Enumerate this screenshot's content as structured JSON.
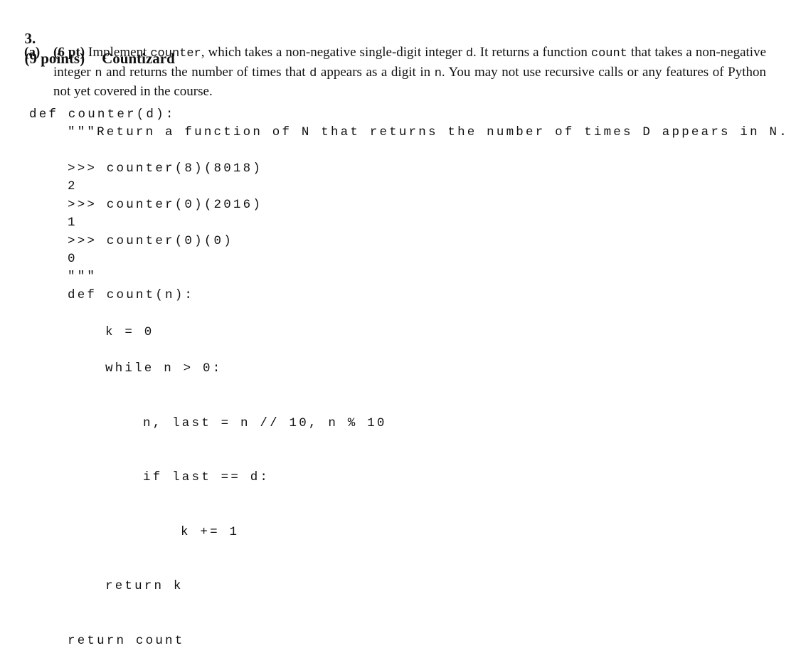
{
  "question": {
    "number": "3.",
    "points": "(9 points)",
    "title": "Countizard"
  },
  "part_a": {
    "label": "(a)",
    "points": "(6 pt)",
    "text_1": " Implement ",
    "code_1": "counter",
    "text_2": ", which takes a non-negative single-digit integer ",
    "code_2": "d",
    "text_3": ". It returns a function ",
    "code_3": "count",
    "text_4": " that takes a non-negative integer ",
    "code_4": "n",
    "text_5": " and returns the number of times that ",
    "code_5": "d",
    "text_6": " appears as a digit in ",
    "code_6": "n",
    "text_7": ". You may not use recursive calls or any features of Python not yet covered in the course."
  },
  "code_lines": [
    "def counter(d):",
    "\"\"\"Return a function of N that returns the number of times D appears in N.",
    ">>> counter(8)(8018)",
    "2",
    ">>> counter(0)(2016)",
    "1",
    ">>> counter(0)(0)",
    "0",
    "\"\"\"",
    "def count(n):",
    "k = 0",
    "while n > 0:",
    "n, last = n // 10, n % 10",
    "if last == d:",
    "k += 1",
    "return k",
    "return count"
  ]
}
